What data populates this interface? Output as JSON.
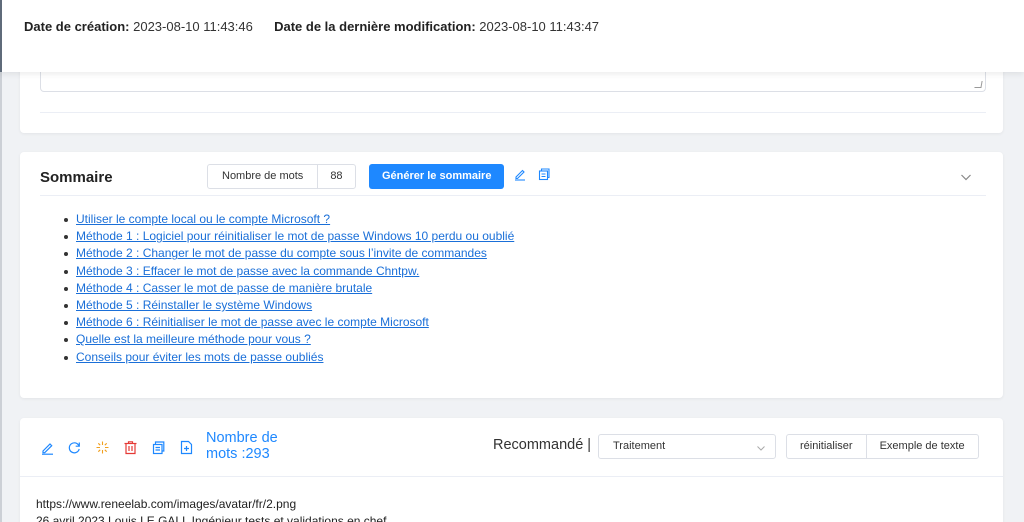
{
  "header": {
    "created_label": "Date de création:",
    "created_value": "2023-08-10 11:43:46",
    "modified_label": "Date de la dernière modification:",
    "modified_value": "2023-08-10 11:43:47"
  },
  "summary": {
    "title": "Sommaire",
    "word_count_label": "Nombre de mots",
    "word_count_value": "88",
    "generate_label": "Générer le sommaire",
    "items": [
      "Utiliser le compte local ou le compte Microsoft ?",
      "Méthode 1 : Logiciel pour réinitialiser le mot de passe Windows 10 perdu ou oublié",
      "Méthode 2 : Changer le mot de passe du compte sous l’invite de commandes",
      "Méthode 3 : Effacer le mot de passe avec la commande Chntpw.",
      "Méthode 4 : Casser le mot de passe de manière brutale",
      "Méthode 5 : Réinstaller le système Windows",
      "Méthode 6 : Réinitialiser le mot de passe avec le compte Microsoft",
      "Quelle est la meilleure méthode pour vous ?",
      "Conseils pour éviter les mots de passe oubliés"
    ]
  },
  "editor": {
    "word_count_line1": "Nombre de",
    "word_count_line2": "mots :293",
    "recommended_label": "Recommandé |",
    "select_value": "Traitement",
    "reset_label": "réinitialiser",
    "example_label": "Exemple de texte",
    "content_line1": "https://www.reneelab.com/images/avatar/fr/2.png",
    "content_line2": "26 avril 2023 Louis LE GALL Ingénieur tests et validations en chef"
  },
  "colors": {
    "accent": "#1e88ff",
    "link": "#1a6fd8",
    "delete": "#e53935",
    "background": "#f0f2f5"
  },
  "icons": {
    "summary_tools": [
      "edit-icon",
      "copy-icon",
      "chevron-down-icon"
    ],
    "editor_tools": [
      "edit-icon",
      "refresh-icon",
      "sparkle-icon",
      "delete-icon",
      "copy-icon",
      "add-file-icon"
    ]
  }
}
